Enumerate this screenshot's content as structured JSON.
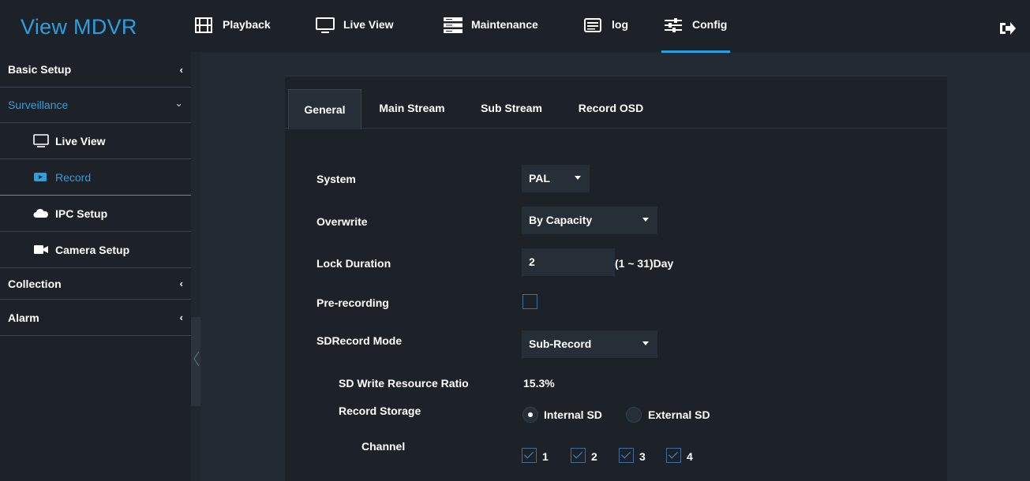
{
  "app": {
    "title": "View MDVR"
  },
  "nav": {
    "items": [
      {
        "label": "Playback",
        "icon": "playback-icon"
      },
      {
        "label": "Live View",
        "icon": "monitor-icon"
      },
      {
        "label": "Maintenance",
        "icon": "maintenance-icon"
      },
      {
        "label": "log",
        "icon": "log-icon"
      },
      {
        "label": "Config",
        "icon": "sliders-icon",
        "active": true
      }
    ],
    "logout_icon": "logout-icon"
  },
  "sidebar": {
    "items": [
      {
        "label": "Basic Setup",
        "chevron": "‹"
      },
      {
        "label": "Surveillance",
        "chevron": "⌄",
        "open": true
      },
      {
        "label": "Live View",
        "icon": "monitor-icon"
      },
      {
        "label": "Record",
        "icon": "record-icon",
        "active": true
      },
      {
        "label": "IPC Setup",
        "icon": "cloud-icon"
      },
      {
        "label": "Camera Setup",
        "icon": "camera-icon"
      },
      {
        "label": "Collection",
        "chevron": "‹"
      },
      {
        "label": "Alarm",
        "chevron": "‹"
      }
    ]
  },
  "tabs": [
    {
      "label": "General",
      "active": true
    },
    {
      "label": "Main Stream"
    },
    {
      "label": "Sub Stream"
    },
    {
      "label": "Record OSD"
    }
  ],
  "form": {
    "system": {
      "label": "System",
      "value": "PAL"
    },
    "overwrite": {
      "label": "Overwrite",
      "value": "By Capacity"
    },
    "lock_duration": {
      "label": "Lock Duration",
      "value": "2",
      "unit": "(1 ~ 31)Day"
    },
    "pre_recording": {
      "label": "Pre-recording",
      "checked": false
    },
    "sd_record_mode": {
      "label": "SDRecord Mode",
      "value": "Sub-Record"
    },
    "sd_write_ratio": {
      "label": "SD Write Resource Ratio",
      "value": "15.3%"
    },
    "record_storage": {
      "label": "Record Storage",
      "options": [
        "Internal SD",
        "External SD"
      ],
      "selected": "Internal SD"
    },
    "channel": {
      "label": "Channel",
      "options": [
        "1",
        "2",
        "3",
        "4"
      ]
    }
  },
  "colors": {
    "accent": "#2c9fe1",
    "background": "#232a33",
    "panel": "#1c2227",
    "field": "#262e37"
  }
}
